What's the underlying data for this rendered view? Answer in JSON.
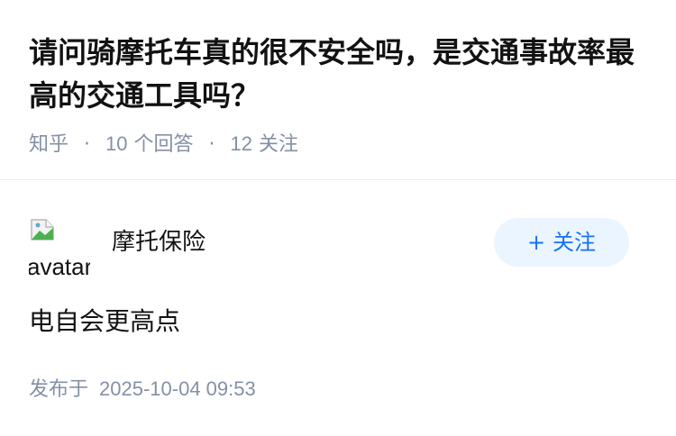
{
  "question": {
    "title": "请问骑摩托车真的很不安全吗，是交通事故率最高的交通工具吗？",
    "source": "知乎",
    "separator": "·",
    "answers_count": "10",
    "answers_label": "个回答",
    "followers_count": "12",
    "followers_label": "关注"
  },
  "answer": {
    "avatar_alt": "avatar",
    "author_name": "摩托保险",
    "follow_button": {
      "icon": "+",
      "label": "关注"
    },
    "content": "电自会更高点",
    "published_label": "发布于",
    "published_time": "2025-10-04 09:53"
  },
  "colors": {
    "title": "#121212",
    "meta": "#8590a6",
    "follow_bg": "#ebf5ff",
    "follow_text": "#1772f6",
    "divider": "#ebebeb"
  }
}
